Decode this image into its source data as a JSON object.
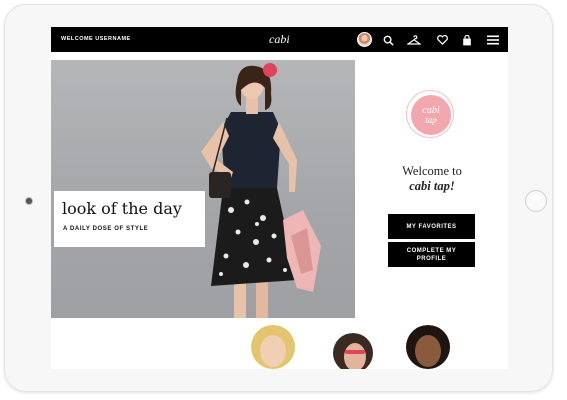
{
  "header": {
    "welcome_text": "WELCOME USERNAME",
    "logo_text": "cabi",
    "icons": [
      "avatar",
      "search-icon",
      "hanger-icon",
      "heart-icon",
      "bag-icon",
      "menu-icon"
    ]
  },
  "hero": {
    "title": "look of the day",
    "subtitle": "A DAILY DOSE OF STYLE"
  },
  "panel": {
    "badge_line1": "cabi",
    "badge_line2": "tap",
    "welcome_line1": "Welcome to",
    "welcome_line2": "cabi tap!",
    "buttons": {
      "favorites": "MY FAVORITES",
      "profile_line1": "COMPLETE MY",
      "profile_line2": "PROFILE"
    }
  },
  "colors": {
    "topbar": "#000000",
    "badge": "#f2a7ae",
    "hero_bg": "#a7a9ac"
  }
}
